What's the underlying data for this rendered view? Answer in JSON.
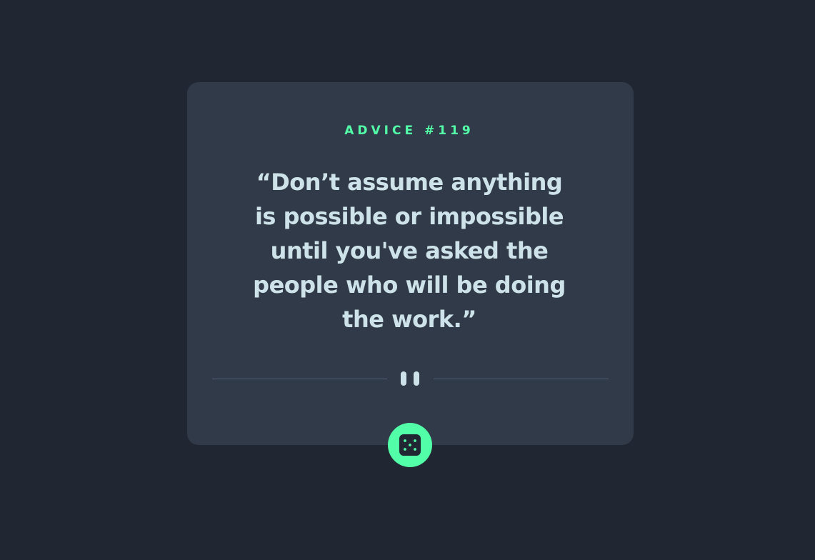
{
  "advice": {
    "id_label": "ADVICE #119",
    "quote": "“Don’t assume anything is possible or impossible until you've asked the people who will be doing the work.”"
  },
  "icons": {
    "divider": "pause-icon",
    "button": "dice-icon"
  },
  "colors": {
    "background": "#202632",
    "card": "#313a48",
    "accent": "#52ffa8",
    "text": "#cee3e9",
    "divider": "#4f5d74"
  }
}
